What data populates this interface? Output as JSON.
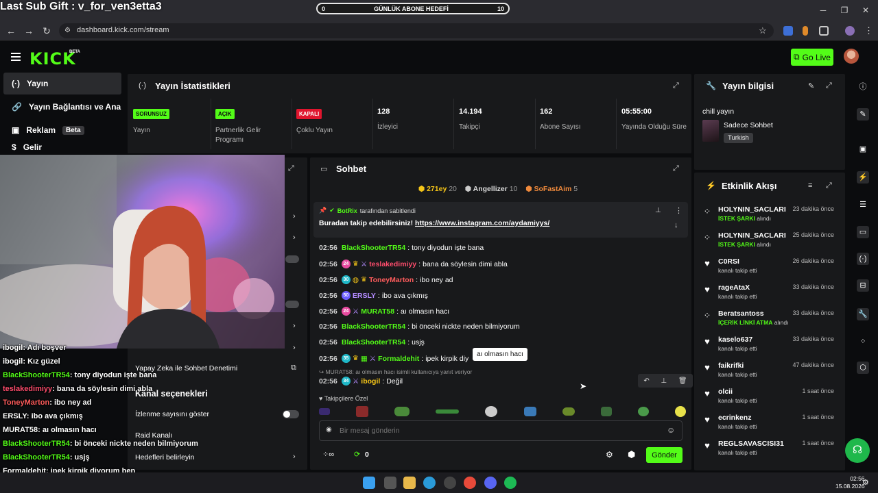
{
  "overlay": {
    "sub_gift": "Last Sub Gift : v_for_ven3etta3",
    "goal": {
      "label": "GÜNLÜK ABONE HEDEFİ",
      "current": "0",
      "target": "10",
      "progress": 0
    },
    "chat": [
      {
        "user": "ibogil",
        "text": "Adı boşver",
        "color": "#ffffff"
      },
      {
        "user": "ibogil",
        "text": "Kız güzel",
        "color": "#ffffff"
      },
      {
        "user": "BlackShooterTR54",
        "text": "tony diyodun işte bana",
        "color": "#53fc18"
      },
      {
        "user": "teslakedimiyy",
        "text": "bana da söylesin dimi abla",
        "color": "#ff4d6d"
      },
      {
        "user": "ToneyMarton",
        "text": "ibo ney ad",
        "color": "#ff5c5c"
      },
      {
        "user": "ERSLY",
        "text": "ibo ava çıkmış",
        "color": "#ffffff"
      },
      {
        "user": "MURAT58",
        "text": "aı olmasın hacı",
        "color": "#ffffff"
      },
      {
        "user": "BlackShooterTR54",
        "text": "bi önceki nickte neden bilmiyorum",
        "color": "#53fc18"
      },
      {
        "user": "BlackShooterTR54",
        "text": "usjş",
        "color": "#53fc18"
      },
      {
        "user": "Formaldehit",
        "text": "ipek kirpik diyorum ben",
        "color": "#ffffff"
      },
      {
        "user": "ibogil",
        "text": "Değil",
        "color": "#ffffff"
      }
    ]
  },
  "browser": {
    "url": "dashboard.kick.com/stream"
  },
  "header": {
    "logo": "KICK",
    "beta": "BETA",
    "go_live": "Go Live"
  },
  "nav": {
    "items": [
      {
        "label": "Yayın",
        "active": true
      },
      {
        "label": "Yayın Bağlantısı ve Anahtarı",
        "active": false
      },
      {
        "label": "Reklam",
        "badge": "Beta",
        "active": false
      },
      {
        "label": "Gelir",
        "active": false
      }
    ]
  },
  "stats": {
    "title": "Yayın İstatistikleri",
    "cells": [
      {
        "badge": "SORUNSUZ",
        "badge_color": "#53fc18",
        "label": "Yayın"
      },
      {
        "badge": "AÇIK",
        "badge_color": "#53fc18",
        "label": "Partnerlik Gelir Programı"
      },
      {
        "badge": "KAPALI",
        "badge_color": "#e0152e",
        "label": "Çoklu Yayın"
      },
      {
        "value": "128",
        "label": "İzleyici"
      },
      {
        "value": "14.194",
        "label": "Takipçi"
      },
      {
        "value": "162",
        "label": "Abone Sayısı"
      },
      {
        "value": "05:55:00",
        "label": "Yayında Olduğu Süre"
      }
    ]
  },
  "info": {
    "title": "Yayın bilgisi",
    "stream_title": "chill yayın",
    "category": "Sadece Sohbet",
    "language": "Turkish"
  },
  "events": {
    "title": "Etkinlik Akışı",
    "items": [
      {
        "name": "HOLYNIN_SACLARI",
        "highlight": "İSTEK ŞARKI",
        "sub": "alındı",
        "time": "23 dakika önce",
        "icon": "redeem-icon"
      },
      {
        "name": "HOLYNIN_SACLARI",
        "highlight": "İSTEK ŞARKI",
        "sub": "alındı",
        "time": "25 dakika önce",
        "icon": "redeem-icon"
      },
      {
        "name": "C0RSI",
        "highlight": "",
        "sub": "kanalı takip etti",
        "time": "26 dakika önce",
        "icon": "heart-icon"
      },
      {
        "name": "rageAtaX",
        "highlight": "",
        "sub": "kanalı takip etti",
        "time": "33 dakika önce",
        "icon": "heart-icon"
      },
      {
        "name": "Beratsantoss",
        "highlight": "İÇERİK LİNKİ ATMA",
        "sub": "alındı",
        "time": "33 dakika önce",
        "icon": "redeem-icon"
      },
      {
        "name": "kaselo637",
        "highlight": "",
        "sub": "kanalı takip etti",
        "time": "33 dakika önce",
        "icon": "heart-icon"
      },
      {
        "name": "faikrifki",
        "highlight": "",
        "sub": "kanalı takip etti",
        "time": "47 dakika önce",
        "icon": "heart-icon"
      },
      {
        "name": "olcii",
        "highlight": "",
        "sub": "kanalı takip etti",
        "time": "1 saat önce",
        "icon": "heart-icon"
      },
      {
        "name": "ecrinkenz",
        "highlight": "",
        "sub": "kanalı takip etti",
        "time": "1 saat önce",
        "icon": "heart-icon"
      },
      {
        "name": "REGLSAVASCISI31",
        "highlight": "",
        "sub": "kanalı takip etti",
        "time": "1 saat önce",
        "icon": "heart-icon"
      }
    ]
  },
  "chat": {
    "title": "Sohbet",
    "leaderboard": [
      {
        "name": "271ey",
        "score": "20",
        "color": "#f5c518",
        "rank": "1"
      },
      {
        "name": "Angellizer",
        "score": "10",
        "color": "#d0d0d0",
        "rank": "2"
      },
      {
        "name": "SoFastAim",
        "score": "5",
        "color": "#f08a3c",
        "rank": "3"
      }
    ],
    "pinned": {
      "by_user": "BotRix",
      "by_suffix": "tarafından sabitlendi",
      "text": "Buradan takip edebilirsiniz!",
      "link": "https://www.instagram.com/aydamiyys/"
    },
    "messages": [
      {
        "time": "02:56",
        "user": "BlackShooterTR54",
        "color": "#53fc18",
        "badges": [],
        "text": "tony diyodun işte bana"
      },
      {
        "time": "02:56",
        "user": "teslakedimiyy",
        "color": "#ff4d6d",
        "badges": [
          "sub-24",
          "crown",
          "sword"
        ],
        "text": "bana da söylesin dimi abla"
      },
      {
        "time": "02:56",
        "user": "ToneyMarton",
        "color": "#ff5c5c",
        "badges": [
          "sub-30",
          "globe",
          "crown"
        ],
        "text": "ibo ney ad"
      },
      {
        "time": "02:56",
        "user": "ERSLY",
        "color": "#b48cff",
        "badges": [
          "sub-50"
        ],
        "text": "ibo ava çıkmış"
      },
      {
        "time": "02:56",
        "user": "MURAT58",
        "color": "#53fc18",
        "badges": [
          "sub-24",
          "sword"
        ],
        "text": "aı olmasın hacı"
      },
      {
        "time": "02:56",
        "user": "BlackShooterTR54",
        "color": "#53fc18",
        "badges": [],
        "text": "bi önceki nickte neden bilmiyorum"
      },
      {
        "time": "02:56",
        "user": "BlackShooterTR54",
        "color": "#53fc18",
        "badges": [],
        "text": "usjş"
      },
      {
        "time": "02:56",
        "user": "Formaldehit",
        "color": "#53fc18",
        "badges": [
          "sub-35",
          "crown",
          "gift",
          "sword"
        ],
        "text": "ipek kirpik diy"
      }
    ],
    "tooltip": "aı olmasın hacı",
    "reply": {
      "context": "MURAT58: aı olmasın hacı isimli kullanıcıya yanıt veriyor",
      "time": "02:56",
      "user": "ibogil",
      "color": "#f5c518",
      "text": "Değil"
    },
    "emote_section": "Takipçilere Özel",
    "input_placeholder": "Bir mesaj gönderin",
    "points": "0",
    "send": "Gönder"
  },
  "mid": {
    "items": [
      {
        "label": "Yapay Zeka ile Sohbet Denetimi"
      }
    ],
    "section_title": "Kanal seçenekleri",
    "options": [
      {
        "label": "İzlenme sayısını göster",
        "toggle": true
      },
      {
        "label": "Raid Kanalı"
      },
      {
        "label": "Hedefleri belirleyin"
      }
    ]
  },
  "taskbar": {
    "time": "02:56",
    "date": "15.08.2026"
  }
}
